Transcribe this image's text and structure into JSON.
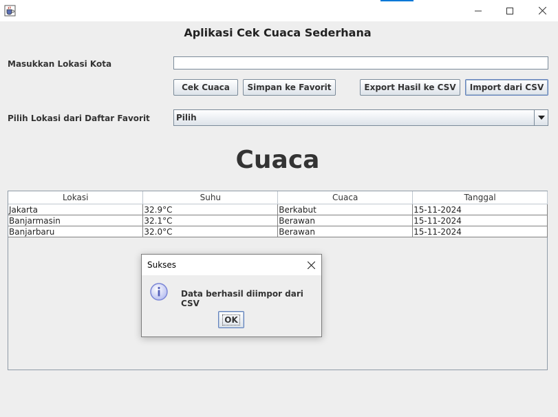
{
  "window": {
    "app_icon": "java-cup-icon",
    "controls": [
      "minimize-icon",
      "maximize-icon",
      "close-icon"
    ]
  },
  "app": {
    "title": "Aplikasi Cek Cuaca Sederhana"
  },
  "form": {
    "location_label": "Masukkan Lokasi Kota",
    "location_value": "",
    "favorite_label": "Pilih Lokasi dari Daftar Favorit",
    "favorite_selected": "Pilih"
  },
  "buttons": {
    "check": "Cek Cuaca",
    "save_favorite": "Simpan ke Favorit",
    "export_csv": "Export Hasil ke CSV",
    "import_csv": "Import dari CSV"
  },
  "section_heading": "Cuaca",
  "table": {
    "columns": [
      "Lokasi",
      "Suhu",
      "Cuaca",
      "Tanggal"
    ],
    "rows": [
      [
        "Jakarta",
        "32.9°C",
        "Berkabut",
        "15-11-2024"
      ],
      [
        "Banjarmasin",
        "32.1°C",
        "Berawan",
        "15-11-2024"
      ],
      [
        "Banjarbaru",
        "32.0°C",
        "Berawan",
        "15-11-2024"
      ]
    ]
  },
  "dialog": {
    "title": "Sukses",
    "message": "Data berhasil diimpor dari CSV",
    "ok_label": "OK",
    "icon": "info-icon"
  },
  "colors": {
    "background": "#eeeeee",
    "accent": "#0078d7",
    "info_icon": "#7b86d6"
  }
}
